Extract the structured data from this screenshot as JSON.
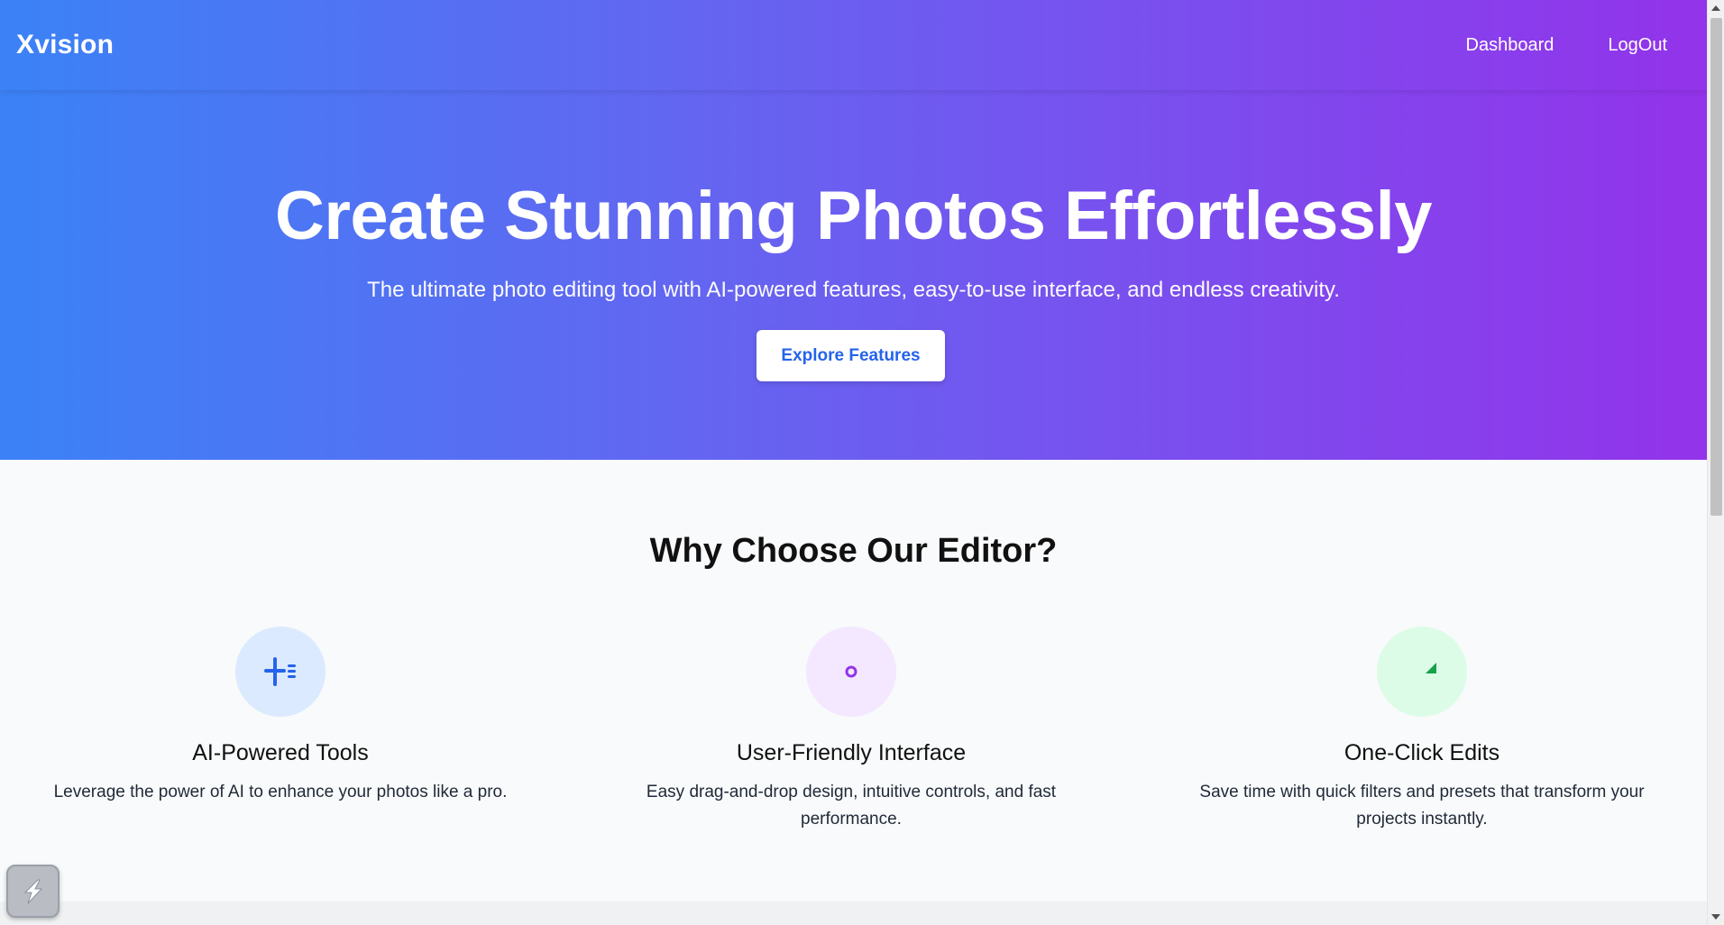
{
  "nav": {
    "brand": "Xvision",
    "links": [
      {
        "label": "Dashboard"
      },
      {
        "label": "LogOut"
      }
    ]
  },
  "hero": {
    "title": "Create Stunning Photos Effortlessly",
    "subtitle": "The ultimate photo editing tool with AI-powered features, easy-to-use interface, and endless creativity.",
    "cta_label": "Explore Features"
  },
  "features": {
    "title": "Why Choose Our Editor?",
    "items": [
      {
        "title": "AI-Powered Tools",
        "description": "Leverage the power of AI to enhance your photos like a pro.",
        "icon": "magic-sparkle-icon",
        "icon_bg": "#dbeafe",
        "icon_color": "#2563eb"
      },
      {
        "title": "User-Friendly Interface",
        "description": "Easy drag-and-drop design, intuitive controls, and fast performance.",
        "icon": "palette-dot-icon",
        "icon_bg": "#f3e8ff",
        "icon_color": "#9333ea"
      },
      {
        "title": "One-Click Edits",
        "description": "Save time with quick filters and presets that transform your projects instantly.",
        "icon": "ruler-triangle-icon",
        "icon_bg": "#dcfce7",
        "icon_color": "#16a34a"
      }
    ]
  },
  "colors": {
    "gradient_start": "#3b82f6",
    "gradient_end": "#9333ea",
    "cta_text": "#2563eb"
  }
}
